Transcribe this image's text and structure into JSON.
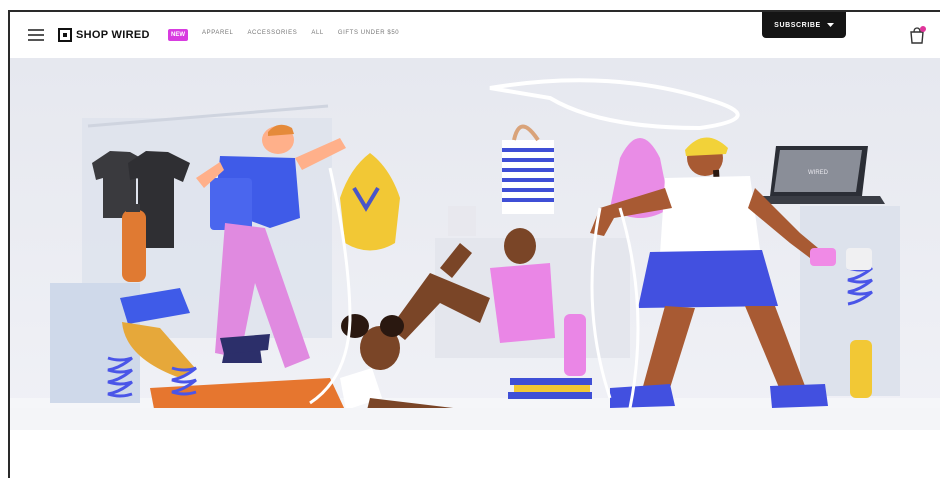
{
  "header": {
    "logo_text": "SHOP WIRED",
    "new_badge": "NEW",
    "menu": [
      "APPAREL",
      "ACCESSORIES",
      "ALL",
      "GIFTS UNDER $50"
    ],
    "subscribe_label": "SUBSCRIBE",
    "cart_count": ""
  },
  "hero": {
    "laptop_screen_text": "WIRED"
  },
  "colors": {
    "accent_pink": "#d83ce0",
    "nav_dark": "#151515",
    "bg": "#e9ebf2"
  }
}
